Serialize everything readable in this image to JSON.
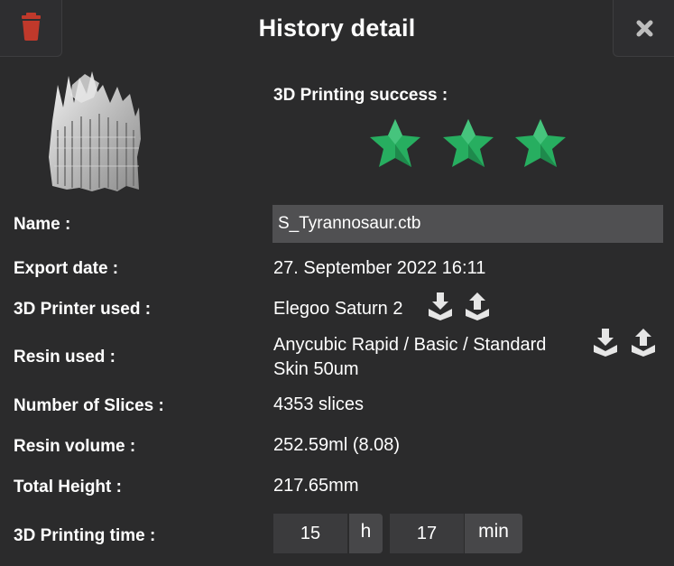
{
  "header": {
    "title": "History detail",
    "trash_icon": "trash-icon",
    "close_icon": "close-icon",
    "trash_color": "#c0392b",
    "close_color": "#bdbdbd"
  },
  "thumbnail": {
    "icon": "model-preview"
  },
  "success": {
    "label": "3D Printing success :",
    "rating": 3,
    "max_rating": 3,
    "star_color": "#27ae60"
  },
  "details": {
    "name_label": "Name :",
    "name_value": "S_Tyrannosaur.ctb",
    "export_label": "Export date :",
    "export_value": "27. September 2022 16:11",
    "printer_label": "3D Printer used :",
    "printer_value": "Elegoo Saturn 2",
    "resin_label": "Resin used :",
    "resin_value_line1": "Anycubic Rapid / Basic / Standard",
    "resin_value_line2": "Skin 50um",
    "slices_label": "Number of Slices :",
    "slices_value": "4353 slices",
    "volume_label": "Resin volume :",
    "volume_value": "252.59ml (8.08)",
    "height_label": "Total Height :",
    "height_value": "217.65mm",
    "time_label": "3D Printing time :"
  },
  "print_time": {
    "hours": "15",
    "hours_unit": "h",
    "minutes": "17",
    "minutes_unit": "min"
  },
  "icons": {
    "download": "download-icon",
    "upload": "upload-icon"
  }
}
